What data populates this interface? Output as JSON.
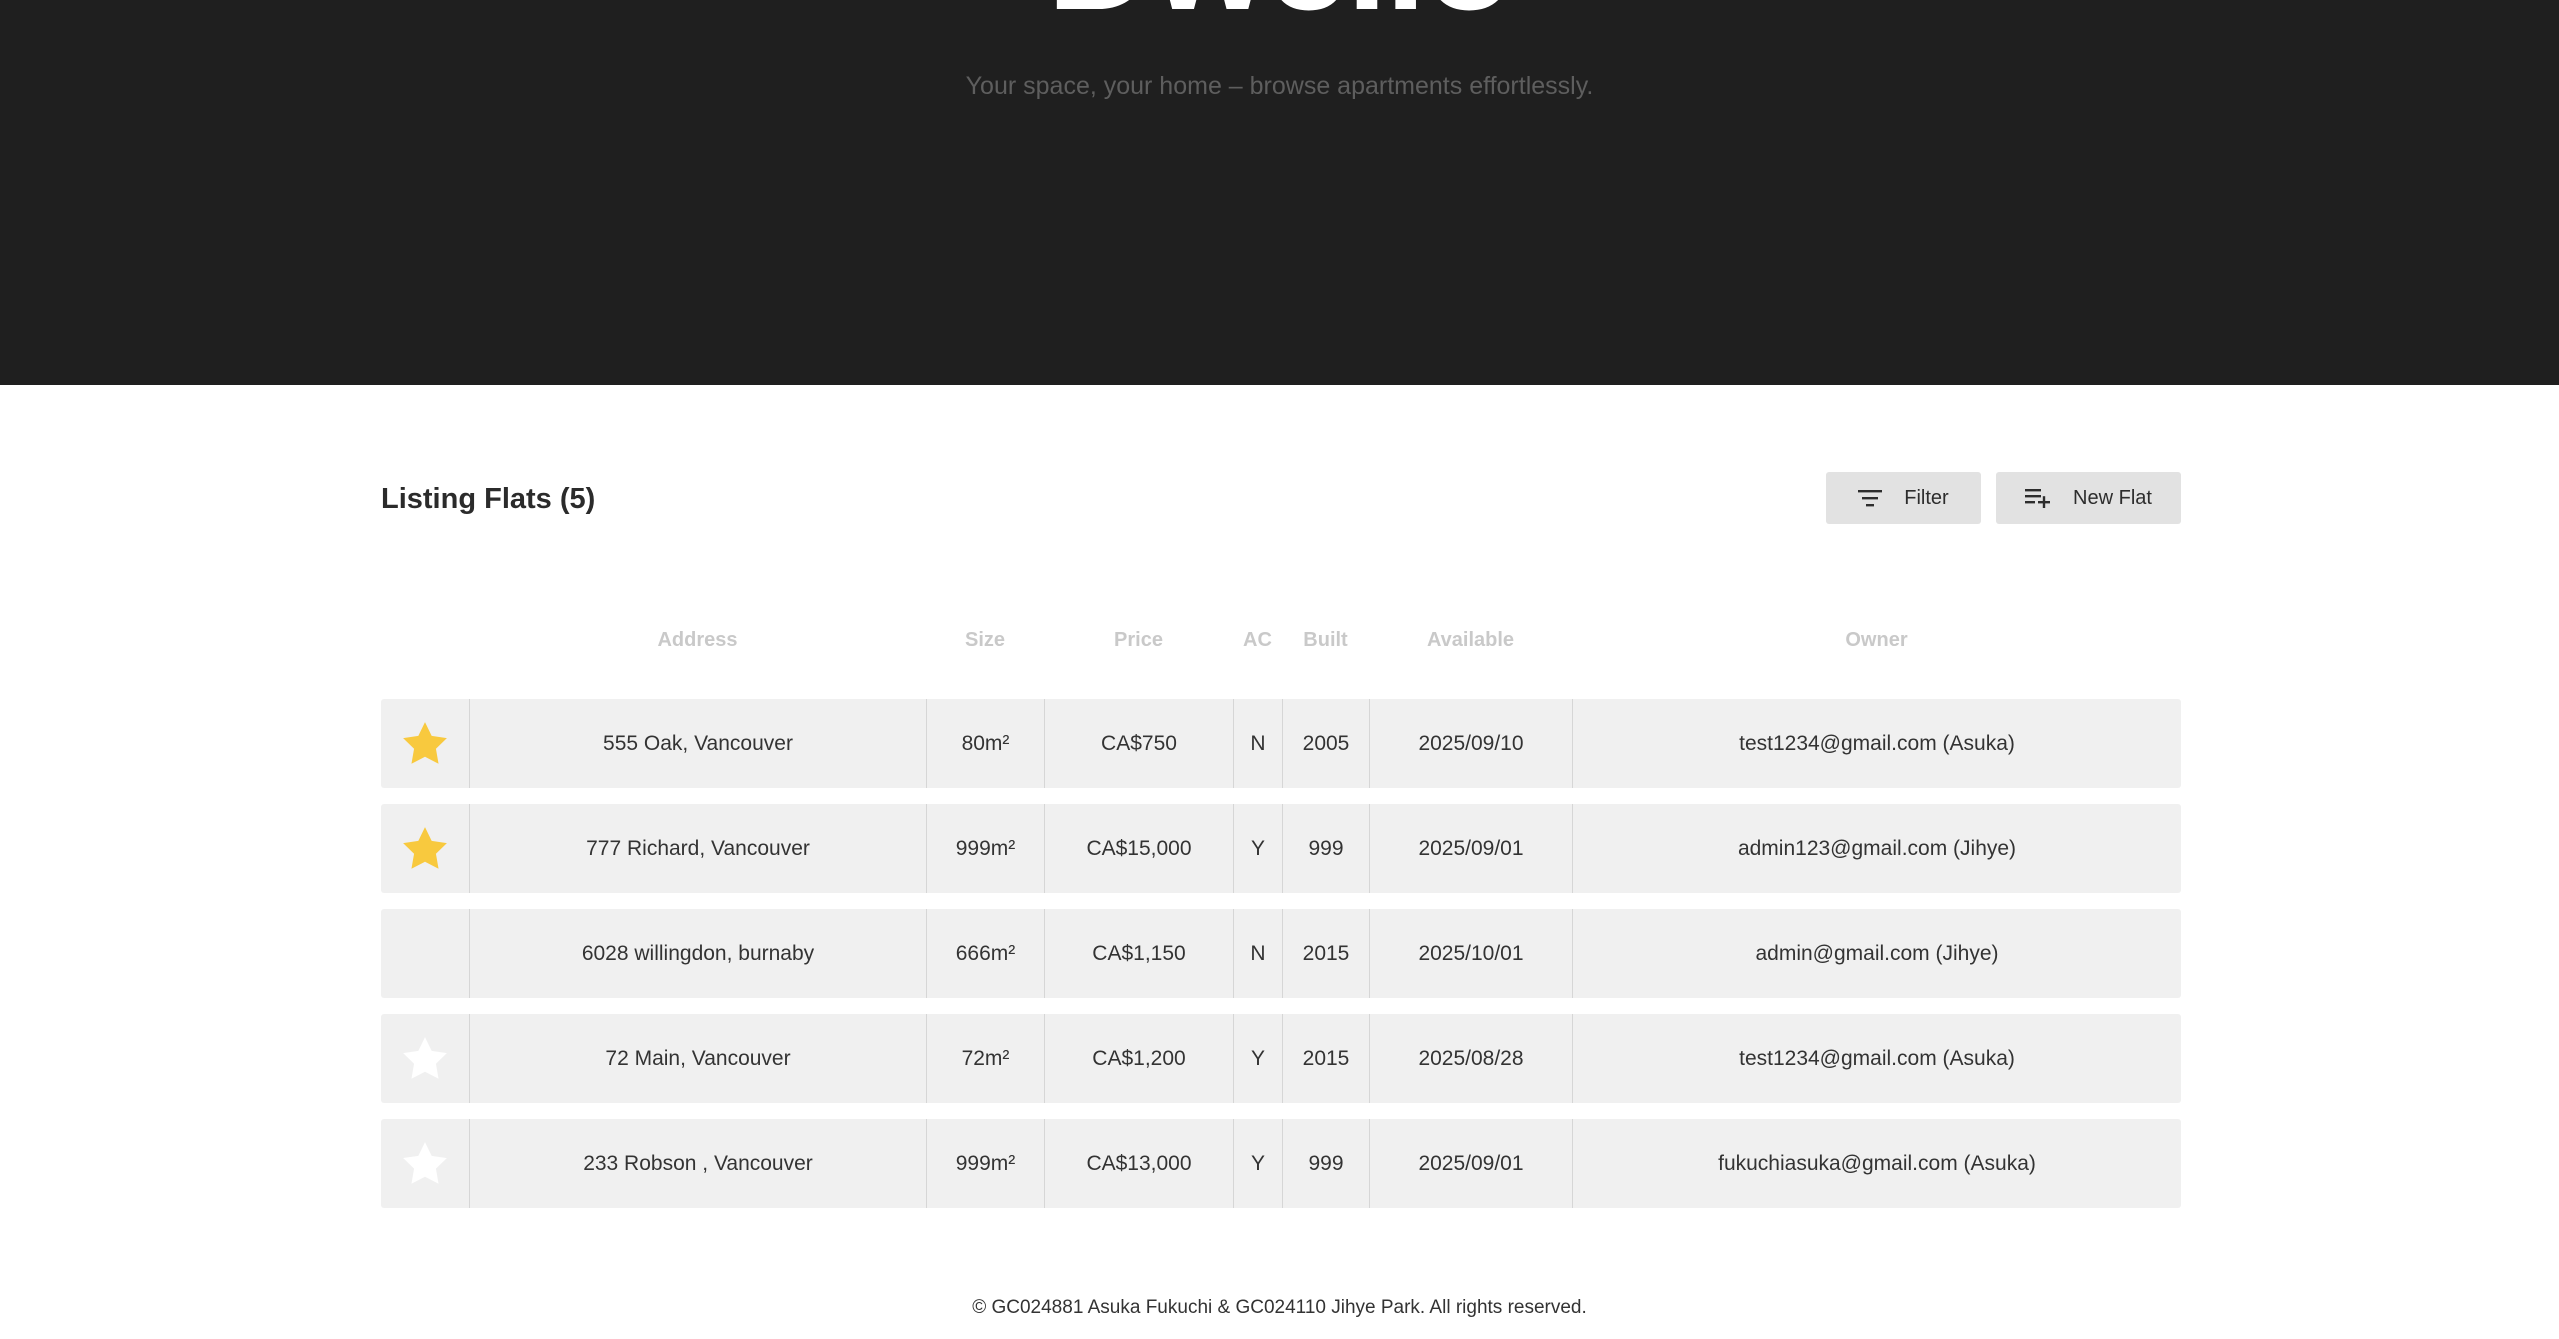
{
  "hero": {
    "title": "Dwello",
    "subtitle": "Your space, your home – browse apartments effortlessly."
  },
  "listing": {
    "heading": "Listing Flats (5)",
    "filter_label": "Filter",
    "new_flat_label": "New Flat"
  },
  "table": {
    "columns": [
      "",
      "Address",
      "Size",
      "Price",
      "AC",
      "Built",
      "Available",
      "Owner"
    ],
    "rows": [
      {
        "favorite": "filled",
        "address": "555 Oak, Vancouver",
        "size": "80m²",
        "price": "CA$750",
        "ac": "N",
        "built": "2005",
        "available": "2025/09/10",
        "owner": "test1234@gmail.com (Asuka)"
      },
      {
        "favorite": "filled",
        "address": "777 Richard, Vancouver",
        "size": "999m²",
        "price": "CA$15,000",
        "ac": "Y",
        "built": "999",
        "available": "2025/09/01",
        "owner": "admin123@gmail.com (Jihye)"
      },
      {
        "favorite": "none",
        "address": "6028 willingdon, burnaby",
        "size": "666m²",
        "price": "CA$1,150",
        "ac": "N",
        "built": "2015",
        "available": "2025/10/01",
        "owner": "admin@gmail.com (Jihye)"
      },
      {
        "favorite": "outline",
        "address": "72 Main, Vancouver",
        "size": "72m²",
        "price": "CA$1,200",
        "ac": "Y",
        "built": "2015",
        "available": "2025/08/28",
        "owner": "test1234@gmail.com (Asuka)"
      },
      {
        "favorite": "outline",
        "address": "233 Robson , Vancouver",
        "size": "999m²",
        "price": "CA$13,000",
        "ac": "Y",
        "built": "999",
        "available": "2025/09/01",
        "owner": "fukuchiasuka@gmail.com (Asuka)"
      }
    ]
  },
  "footer": {
    "text": "© GC024881 Asuka Fukuchi & GC024110 Jihye Park. All rights reserved."
  },
  "colors": {
    "hero_bg": "#1f1f1f",
    "star_filled": "#f8c93e",
    "star_outline": "#ffffff",
    "row_bg": "#f0f0f0",
    "button_bg": "#e2e2e2"
  }
}
